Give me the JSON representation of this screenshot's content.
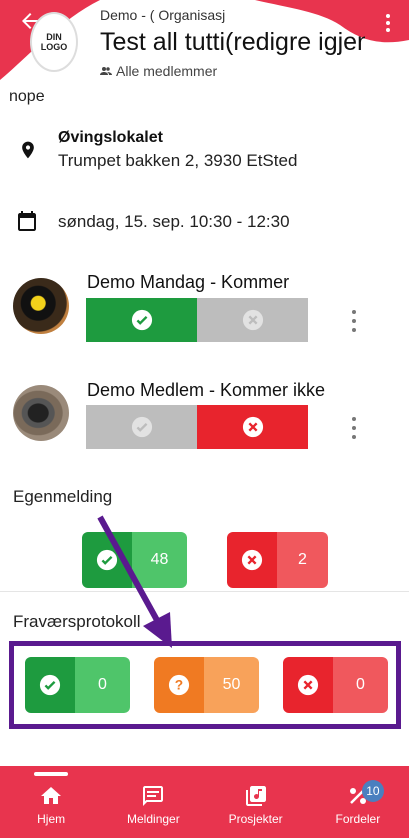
{
  "header": {
    "org_label": "Demo - ( Organisasj",
    "title": "Test all tutti(redigre igjen",
    "audience": "Alle medlemmer",
    "logo_text": "DIN LOGO"
  },
  "description": "nope",
  "location": {
    "name": "Øvingslokalet",
    "address": "Trumpet bakken 2, 3930 EtSted"
  },
  "datetime": "søndag, 15. sep. 10:30 - 12:30",
  "members": [
    {
      "name": "Demo Mandag - Kommer",
      "status": "yes"
    },
    {
      "name": "Demo Medlem - Kommer ikke",
      "status": "no"
    }
  ],
  "self_registration": {
    "title": "Egenmelding",
    "yes": "48",
    "no": "2"
  },
  "absence_protocol": {
    "title": "Fraværsprotokoll",
    "present": "0",
    "unknown": "50",
    "absent": "0"
  },
  "colors": {
    "brand": "#e8344e",
    "green": "#1e9b3f",
    "red": "#e8242d",
    "orange": "#f07a22",
    "highlight": "#5a1a8f"
  },
  "nav": [
    {
      "label": "Hjem",
      "icon": "home-icon",
      "active": true
    },
    {
      "label": "Meldinger",
      "icon": "message-icon"
    },
    {
      "label": "Prosjekter",
      "icon": "music-library-icon"
    },
    {
      "label": "Fordeler",
      "icon": "percent-icon",
      "badge": "10"
    }
  ]
}
